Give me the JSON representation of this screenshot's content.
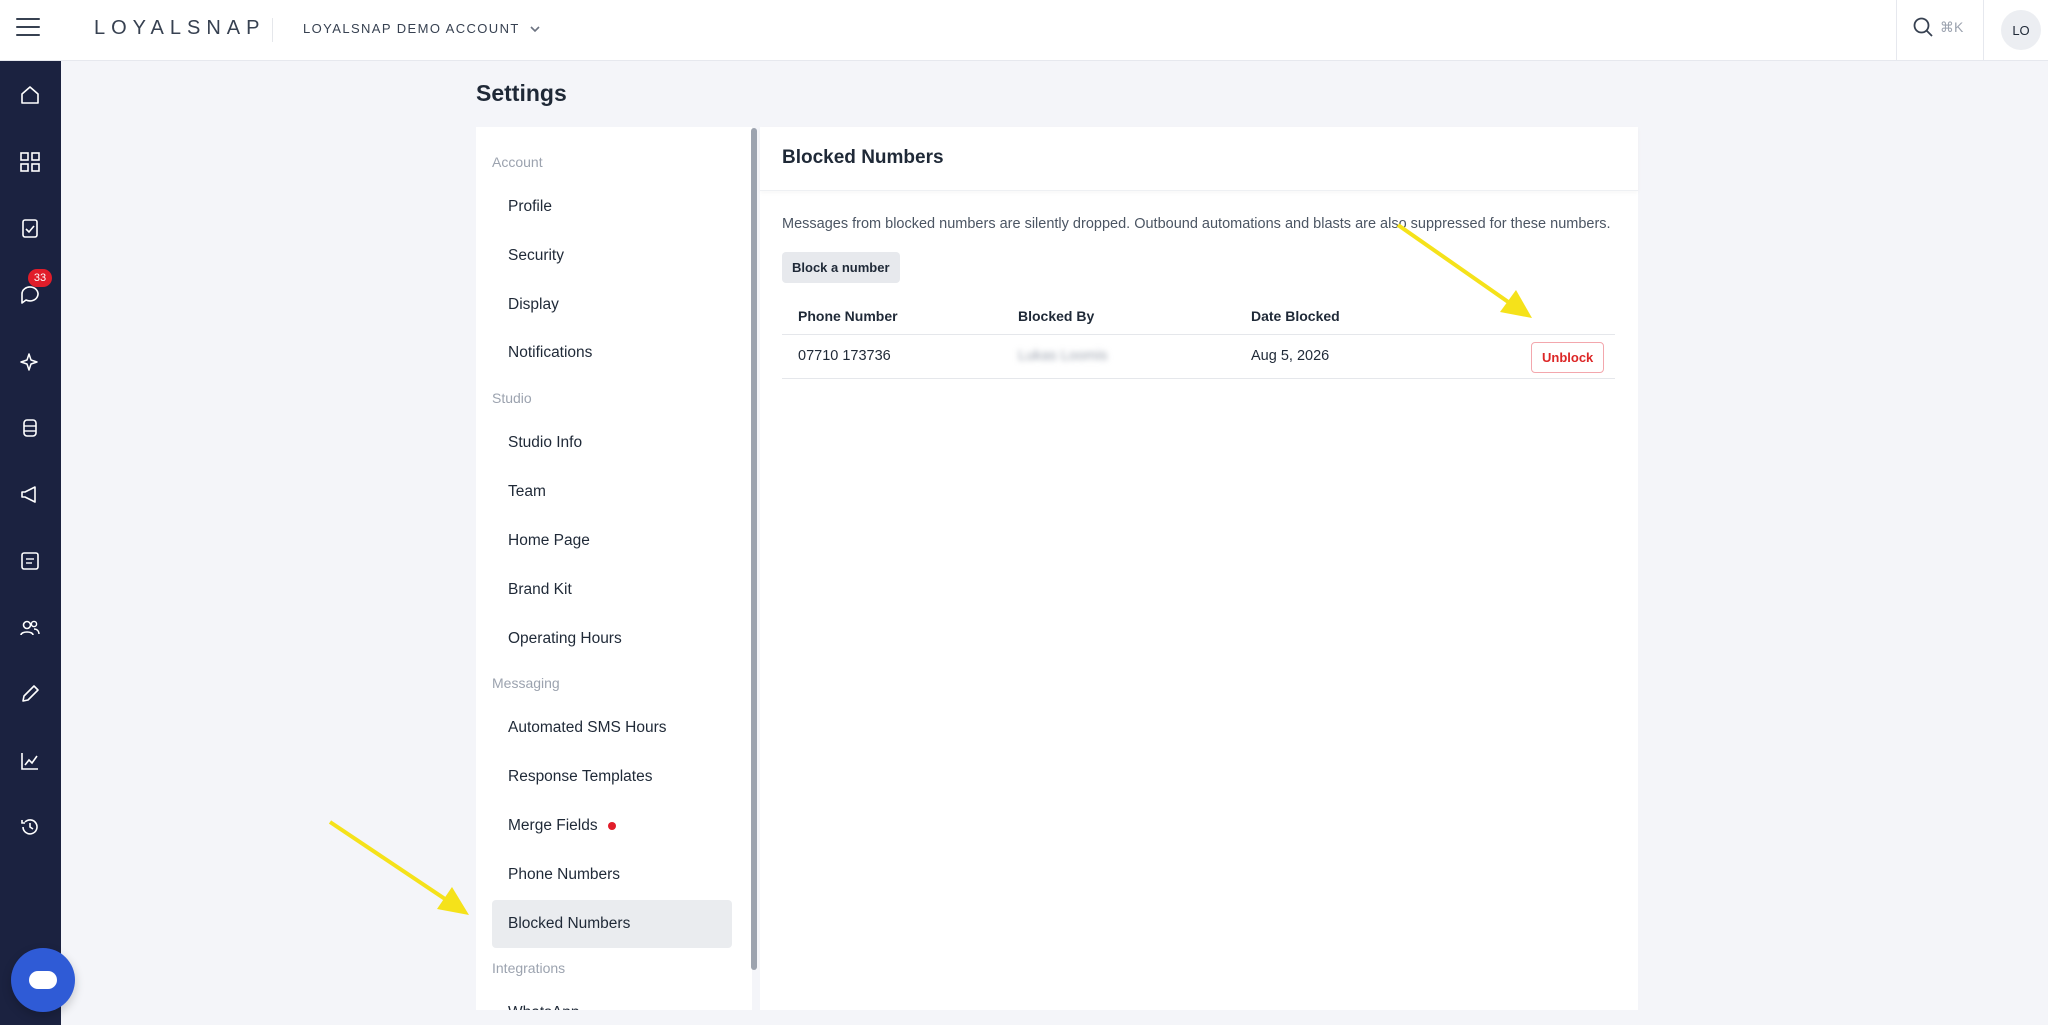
{
  "topbar": {
    "logo": "LOYALSNAP",
    "account": "LOYALSNAP DEMO ACCOUNT",
    "search_shortcut": "⌘K",
    "avatar_initials": "LO"
  },
  "rail": {
    "badge_count": "33",
    "icons": [
      "home-icon",
      "grid-icon",
      "tasks-icon",
      "chat-icon",
      "sparkle-icon",
      "stack-icon",
      "megaphone-icon",
      "document-icon",
      "users-icon",
      "pen-icon",
      "chart-icon",
      "history-icon"
    ]
  },
  "page": {
    "title": "Settings"
  },
  "nav": {
    "sections": [
      {
        "label": "Account"
      },
      {
        "label": "Studio"
      },
      {
        "label": "Messaging"
      },
      {
        "label": "Integrations"
      }
    ],
    "items": [
      {
        "label": "Profile"
      },
      {
        "label": "Security"
      },
      {
        "label": "Display"
      },
      {
        "label": "Notifications"
      },
      {
        "label": "Studio Info"
      },
      {
        "label": "Team"
      },
      {
        "label": "Home Page"
      },
      {
        "label": "Brand Kit"
      },
      {
        "label": "Operating Hours"
      },
      {
        "label": "Automated SMS Hours"
      },
      {
        "label": "Response Templates"
      },
      {
        "label": "Merge Fields"
      },
      {
        "label": "Phone Numbers"
      },
      {
        "label": "Blocked Numbers"
      },
      {
        "label": "WhatsApp"
      }
    ]
  },
  "content": {
    "title": "Blocked Numbers",
    "description": "Messages from blocked numbers are silently dropped. Outbound automations and blasts are also suppressed for these numbers.",
    "block_button": "Block a number",
    "columns": [
      "Phone Number",
      "Blocked By",
      "Date Blocked"
    ],
    "rows": [
      {
        "phone": "07710 173736",
        "blocked_by": "Lukas Loomis",
        "date": "Aug 5, 2026",
        "action": "Unblock"
      }
    ]
  },
  "colors": {
    "rail_bg": "#1b2240",
    "badge": "#e11d2a",
    "chat_fab": "#2f5bd6",
    "unblock": "#dc2626",
    "annotation_arrow": "#f5e21a"
  }
}
